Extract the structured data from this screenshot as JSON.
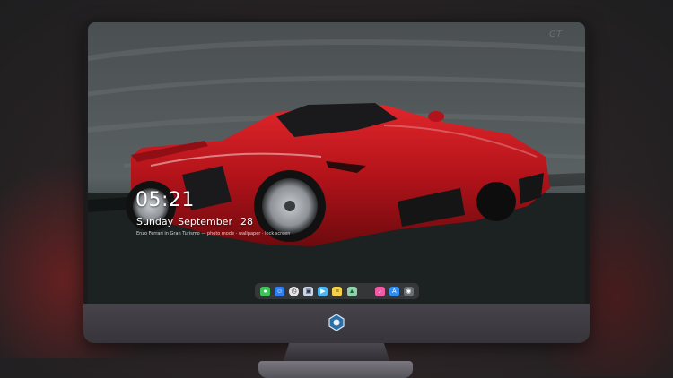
{
  "lock_screen": {
    "time": "05:21",
    "weekday": "Sunday",
    "month": "September",
    "day": "28",
    "caption": "Enzo Ferrari in Gran Turismo — photo mode  ·  wallpaper  ·  lock screen"
  },
  "dock": {
    "apps": [
      {
        "name": "messages",
        "icon": "message-bubble-icon",
        "color": "#3fc45a"
      },
      {
        "name": "finder",
        "icon": "finder-face-icon",
        "color": "#2f7ff0"
      },
      {
        "name": "clock",
        "icon": "clock-icon",
        "color": "#e6e6e6"
      },
      {
        "name": "preview",
        "icon": "photos-frame-icon",
        "color": "#c9d6e3"
      },
      {
        "name": "clips",
        "icon": "clapper-icon",
        "color": "#4ab7f2"
      },
      {
        "name": "notes",
        "icon": "notes-pad-icon",
        "color": "#f3d24b"
      },
      {
        "name": "photos",
        "icon": "image-icon",
        "color": "#8fd1a8"
      },
      {
        "name": "music",
        "icon": "music-note-icon",
        "color": "#f25aa7"
      },
      {
        "name": "app-store",
        "icon": "app-store-icon",
        "color": "#2f8df3"
      },
      {
        "name": "screenshot",
        "icon": "camera-icon",
        "color": "#6a6d72"
      }
    ]
  },
  "colors": {
    "car_red": "#c0161b",
    "screen_bg": "#1d2121",
    "bezel": "#1b1b1c",
    "chin": "#3f3c43"
  }
}
